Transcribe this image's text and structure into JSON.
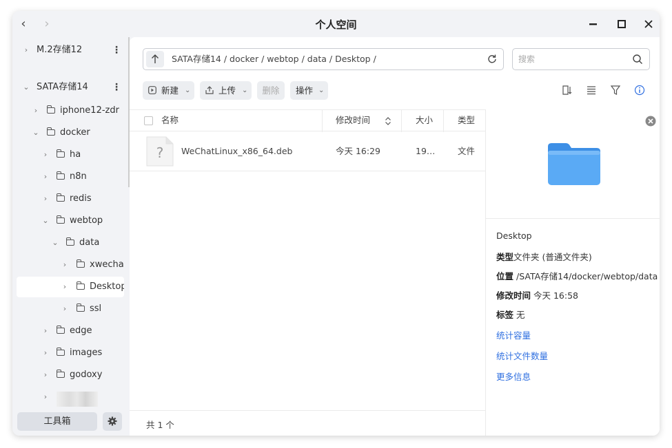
{
  "window": {
    "title": "个人空间"
  },
  "sidebar": {
    "items": [
      {
        "label": "M.2存储12",
        "level": 0,
        "expanded": false
      },
      {
        "label": "SATA存储14",
        "level": 0,
        "expanded": true
      },
      {
        "label": "iphone12-zdr",
        "level": 1
      },
      {
        "label": "docker",
        "level": 1,
        "expanded": true
      },
      {
        "label": "ha",
        "level": 2
      },
      {
        "label": "n8n",
        "level": 2
      },
      {
        "label": "redis",
        "level": 2
      },
      {
        "label": "webtop",
        "level": 2,
        "expanded": true
      },
      {
        "label": "data",
        "level": 3,
        "expanded": true
      },
      {
        "label": "xwechat_",
        "level": 4
      },
      {
        "label": "Desktop",
        "level": 4,
        "selected": true
      },
      {
        "label": "ssl",
        "level": 4
      },
      {
        "label": "edge",
        "level": 2
      },
      {
        "label": "images",
        "level": 2
      },
      {
        "label": "godoxy",
        "level": 2
      }
    ],
    "toolbox_label": "工具箱"
  },
  "pathbar": {
    "path": "SATA存储14 / docker / webtop / data / Desktop /"
  },
  "search": {
    "placeholder": "搜索"
  },
  "toolbar": {
    "new_label": "新建",
    "upload_label": "上传",
    "delete_label": "删除",
    "actions_label": "操作"
  },
  "table": {
    "headers": {
      "name": "名称",
      "modified": "修改时间",
      "size": "大小",
      "type": "类型"
    },
    "rows": [
      {
        "name": "WeChatLinux_x86_64.deb",
        "modified": "今天 16:29",
        "size": "19…",
        "type": "文件"
      }
    ]
  },
  "detail": {
    "name": "Desktop",
    "type_label": "类型",
    "type_value": "文件夹 (普通文件夹)",
    "location_label": "位置",
    "location_value": " /SATA存储14/docker/webtop/data",
    "modified_label": "修改时间",
    "modified_value": " 今天 16:58",
    "tags_label": "标签",
    "tags_value": " 无",
    "link_capacity": "统计容量",
    "link_count": "统计文件数量",
    "link_more": "更多信息"
  },
  "footer": {
    "count": "共 1 个"
  },
  "colors": {
    "accent": "#2f6fe0",
    "folder": "#4a9ff0",
    "window_bg": "#f2f3f6"
  }
}
